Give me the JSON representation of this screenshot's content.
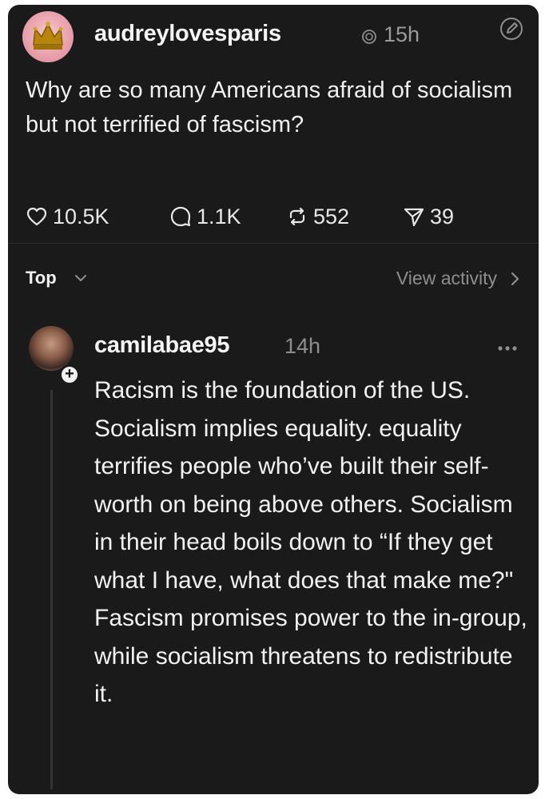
{
  "post": {
    "username": "audreylovesparis",
    "time": "15h",
    "text": "Why are so many Americans afraid of socialism but not terrified of fascism?",
    "stats": {
      "likes": "10.5K",
      "replies": "1.1K",
      "reposts": "552",
      "shares": "39"
    }
  },
  "sort": {
    "label": "Top",
    "view_activity": "View activity"
  },
  "reply": {
    "username": "camilabae95",
    "time": "14h",
    "paragraphs": [
      "Racism is the foundation of the US. Socialism implies equality. equality terrifies people who’ve built their self-worth on being above others. Socialism in their head boils down to “If they get what I have, what does that make me?\"",
      "Fascism promises power to the in-group, while socialism threatens to redistribute it."
    ]
  },
  "colors": {
    "background": "#1a1a1a",
    "text": "#f2f2f2",
    "muted": "#8e8e8e",
    "avatar_pink": "#e9a2ad"
  },
  "icons": [
    "crown-avatar-icon",
    "verified-icon",
    "edit-icon",
    "heart-icon",
    "comment-icon",
    "repost-icon",
    "share-icon",
    "chevron-down-icon",
    "chevron-right-icon",
    "more-icon",
    "plus-icon"
  ]
}
